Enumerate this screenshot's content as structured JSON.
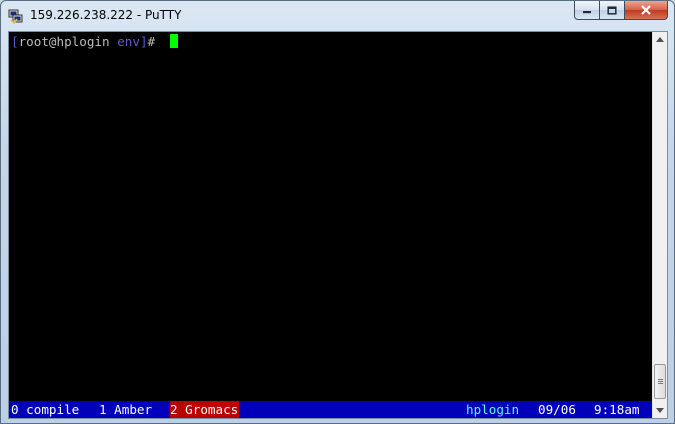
{
  "window": {
    "title": "159.226.238.222 - PuTTY",
    "app_icon": "putty-icon",
    "buttons": {
      "minimize_icon": "minimize-icon",
      "maximize_icon": "maximize-icon",
      "close_icon": "close-icon"
    }
  },
  "terminal": {
    "prompt": {
      "open_bracket": "[",
      "user_host": "root@hplogin",
      "space": " ",
      "cwd": "env",
      "close_bracket": "]",
      "symbol": "# "
    },
    "cursor_color": "#00ff00",
    "background": "#000000"
  },
  "statusbar": {
    "windows": [
      {
        "label": "0 compile",
        "active": false
      },
      {
        "label": "1 Amber",
        "active": false
      },
      {
        "label": "2 Gromacs",
        "active": true
      }
    ],
    "hostname": "hplogin",
    "date": "09/06",
    "time": "9:18am",
    "colors": {
      "bar": "#0000bb",
      "active": "#bb0000",
      "hostname": "#55ffff"
    }
  },
  "scrollbar": {
    "up_icon": "scroll-up-arrow-icon",
    "down_icon": "scroll-down-arrow-icon",
    "position": 1.0
  }
}
